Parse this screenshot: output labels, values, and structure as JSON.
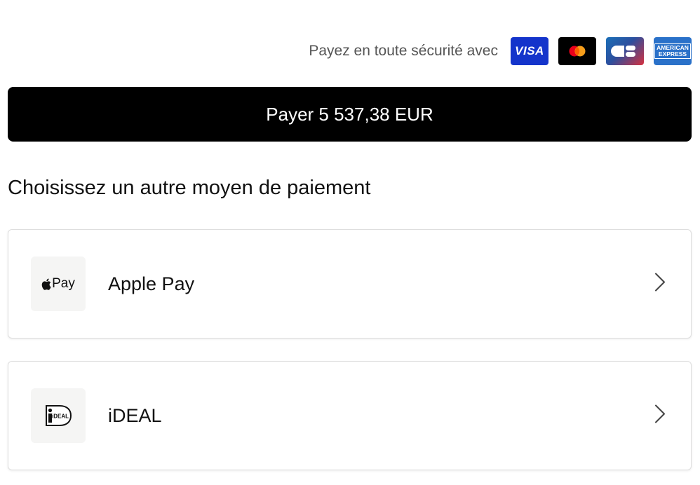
{
  "secure": {
    "text": "Payez en toute sécurité avec",
    "cards": [
      {
        "icon": "visa-logo-icon",
        "label": "VISA",
        "color": "#1434cb"
      },
      {
        "icon": "mastercard-logo-icon",
        "color": "#000000"
      },
      {
        "icon": "cb-logo-icon"
      },
      {
        "icon": "amex-logo-icon",
        "line1": "American",
        "line2": "Express",
        "color": "#2a71c9"
      }
    ]
  },
  "pay_button": {
    "label": "Payer 5 537,38 EUR"
  },
  "other_methods": {
    "heading": "Choisissez un autre moyen de paiement",
    "items": [
      {
        "label": "Apple Pay",
        "icon": "apple-pay-icon",
        "icon_text": "Pay"
      },
      {
        "label": "iDEAL",
        "icon": "ideal-icon",
        "icon_text": "iDEAL"
      }
    ]
  },
  "colors": {
    "accent": "#000000",
    "card_border": "#dedede",
    "icon_bg": "#f5f5f4"
  }
}
